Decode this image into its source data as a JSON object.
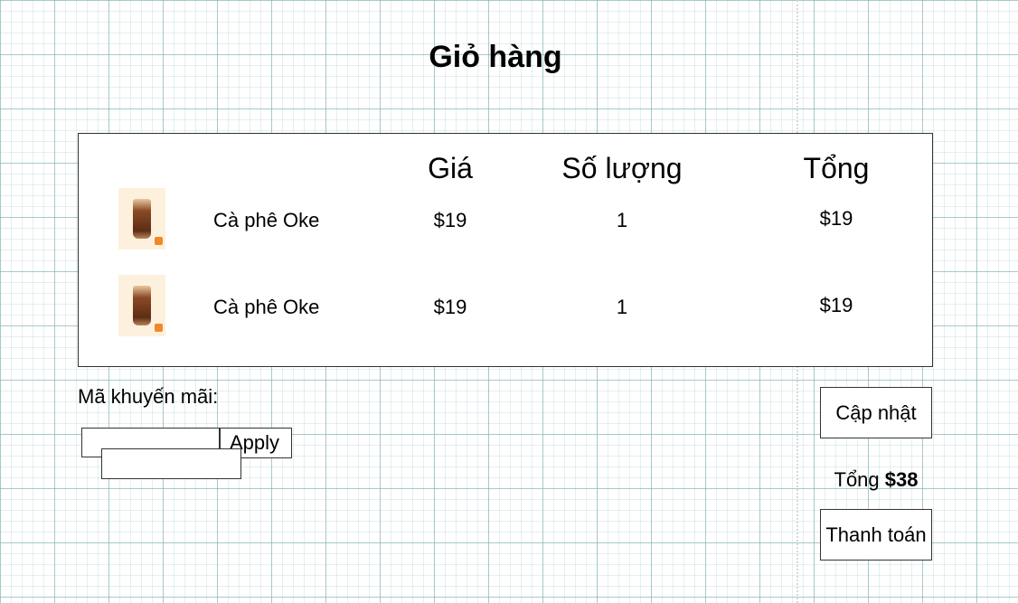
{
  "page": {
    "title": "Giỏ hàng"
  },
  "cart": {
    "headers": {
      "price": "Giá",
      "quantity": "Số lượng",
      "total": "Tổng"
    },
    "items": [
      {
        "image_icon": "iced-coffee-icon",
        "name": "Cà phê Oke",
        "price": "$19",
        "quantity": "1",
        "total": "$19"
      },
      {
        "image_icon": "iced-coffee-icon",
        "name": "Cà phê Oke",
        "price": "$19",
        "quantity": "1",
        "total": "$19"
      }
    ]
  },
  "promo": {
    "label": "Mã khuyến mãi:",
    "input_value": "",
    "apply_label": "Apply",
    "second_input_value": ""
  },
  "actions": {
    "update_label": "Cập nhật",
    "total_label": "Tổng",
    "total_value": "$38",
    "checkout_label": "Thanh toán"
  },
  "colors": {
    "grid": "#78aaaa",
    "thumb_bg": "#fdf1dd",
    "like_icon": "#f0882a",
    "border": "#333333"
  }
}
